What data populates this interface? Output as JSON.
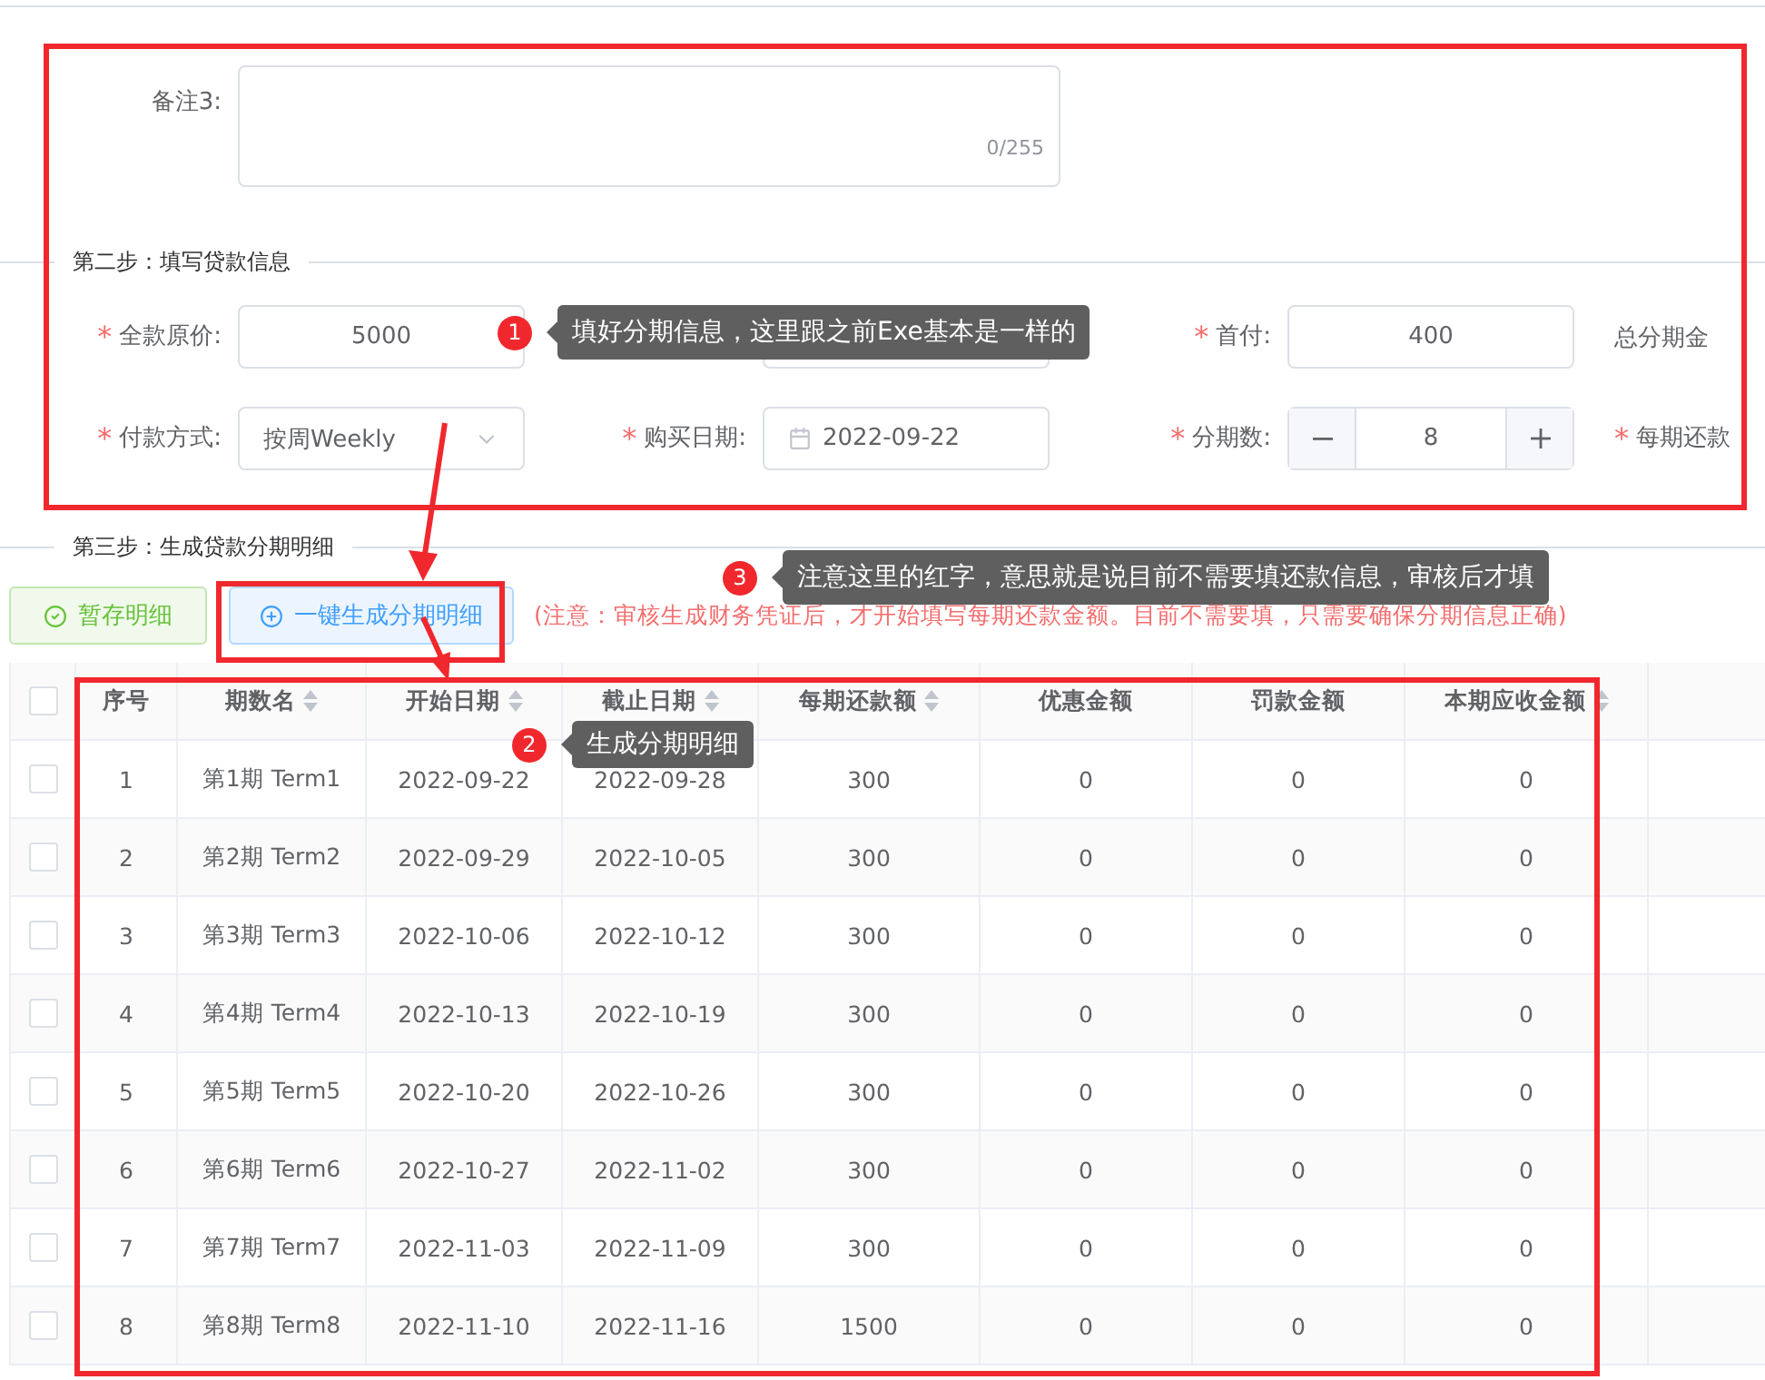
{
  "remark": {
    "label": "备注3:",
    "counter": "0/255"
  },
  "step2": {
    "title": "第二步：填写贷款信息",
    "rows": [
      [
        {
          "kind": "text",
          "label": "全款原价:",
          "mark": "*",
          "value": "5000"
        },
        {
          "kind": "covered"
        },
        {
          "kind": "text",
          "label": "首付:",
          "mark": "*",
          "value": "400"
        },
        {
          "kind": "cut",
          "label": "总分期金"
        }
      ],
      [
        {
          "kind": "select",
          "label": "付款方式:",
          "mark": "*",
          "value": "按周Weekly"
        },
        {
          "kind": "date",
          "label": "购买日期:",
          "mark": "*",
          "value": "2022-09-22"
        },
        {
          "kind": "stepper",
          "label": "分期数:",
          "mark": "*",
          "value": "8"
        },
        {
          "kind": "cut",
          "label": "每期还款",
          "mark": "*"
        }
      ]
    ]
  },
  "step3": {
    "title": "第三步：生成贷款分期明细",
    "buttons": [
      {
        "kind": "save",
        "label": "暂存明细"
      },
      {
        "kind": "generate",
        "label": "一键生成分期明细"
      }
    ],
    "note": "(注意：审核生成财务凭证后，才开始填写每期还款金额。目前不需要填，只需要确保分期信息正确)"
  },
  "table": {
    "select_all": {
      "checked": false
    },
    "columns": [
      {
        "label": "序号",
        "sortable": false
      },
      {
        "label": "期数名",
        "sortable": true
      },
      {
        "label": "开始日期",
        "sortable": true
      },
      {
        "label": "截止日期",
        "sortable": true
      },
      {
        "label": "每期还款额",
        "sortable": true
      },
      {
        "label": "优惠金额",
        "sortable": false
      },
      {
        "label": "罚款金额",
        "sortable": false
      },
      {
        "label": "本期应收金额",
        "sortable": true
      }
    ],
    "rows": [
      {
        "checked": false,
        "cells": [
          "1",
          "第1期 Term1",
          "2022-09-22",
          "2022-09-28",
          "300",
          "0",
          "0",
          "0"
        ]
      },
      {
        "checked": false,
        "cells": [
          "2",
          "第2期 Term2",
          "2022-09-29",
          "2022-10-05",
          "300",
          "0",
          "0",
          "0"
        ]
      },
      {
        "checked": false,
        "cells": [
          "3",
          "第3期 Term3",
          "2022-10-06",
          "2022-10-12",
          "300",
          "0",
          "0",
          "0"
        ]
      },
      {
        "checked": false,
        "cells": [
          "4",
          "第4期 Term4",
          "2022-10-13",
          "2022-10-19",
          "300",
          "0",
          "0",
          "0"
        ]
      },
      {
        "checked": false,
        "cells": [
          "5",
          "第5期 Term5",
          "2022-10-20",
          "2022-10-26",
          "300",
          "0",
          "0",
          "0"
        ]
      },
      {
        "checked": false,
        "cells": [
          "6",
          "第6期 Term6",
          "2022-10-27",
          "2022-11-02",
          "300",
          "0",
          "0",
          "0"
        ]
      },
      {
        "checked": false,
        "cells": [
          "7",
          "第7期 Term7",
          "2022-11-03",
          "2022-11-09",
          "300",
          "0",
          "0",
          "0"
        ]
      },
      {
        "checked": false,
        "cells": [
          "8",
          "第8期 Term8",
          "2022-11-10",
          "2022-11-16",
          "1500",
          "0",
          "0",
          "0"
        ]
      }
    ]
  },
  "annotations": [
    {
      "number": "1",
      "text": "填好分期信息，这里跟之前Exe基本是一样的"
    },
    {
      "number": "2",
      "text": "生成分期明细"
    },
    {
      "number": "3",
      "text": "注意这里的红字，意思就是说目前不需要填还款信息，审核后才填"
    }
  ]
}
